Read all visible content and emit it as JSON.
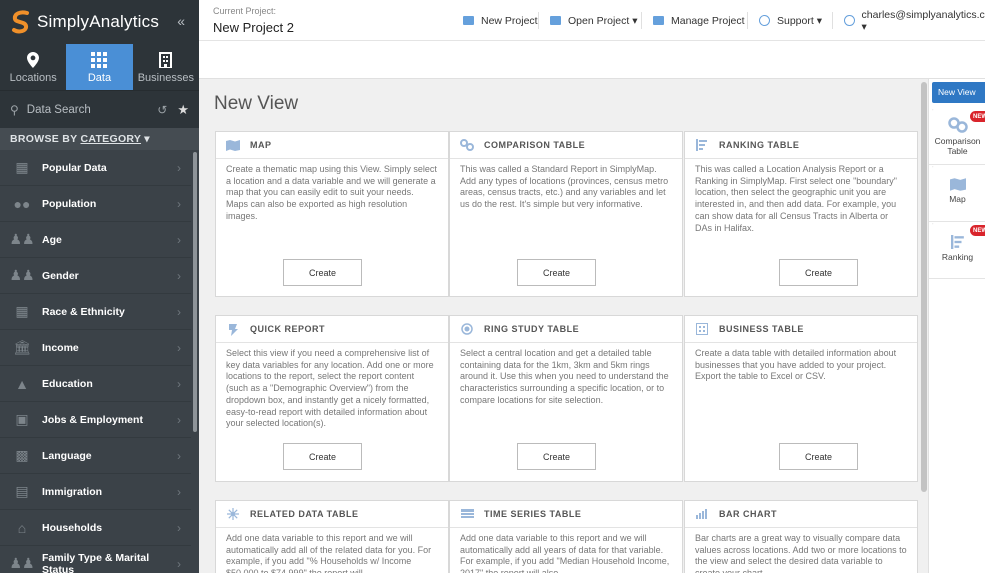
{
  "app": {
    "name": "SimplyAnalytics",
    "collapse_glyph": "«"
  },
  "sidebar": {
    "tabs": [
      {
        "label": "Locations",
        "icon": "map-pin-icon",
        "active": false
      },
      {
        "label": "Data",
        "icon": "data-grid-icon",
        "active": true
      },
      {
        "label": "Businesses",
        "icon": "building-icon",
        "active": false
      }
    ],
    "search_placeholder": "Data Search",
    "browse_prefix": "BROWSE BY ",
    "browse_link": "CATEGORY",
    "browse_caret": "▾",
    "categories": [
      {
        "label": "Popular Data",
        "icon": "popular-data-icon"
      },
      {
        "label": "Population",
        "icon": "population-icon"
      },
      {
        "label": "Age",
        "icon": "age-icon"
      },
      {
        "label": "Gender",
        "icon": "gender-icon"
      },
      {
        "label": "Race & Ethnicity",
        "icon": "race-ethnicity-icon"
      },
      {
        "label": "Income",
        "icon": "income-icon"
      },
      {
        "label": "Education",
        "icon": "education-icon"
      },
      {
        "label": "Jobs & Employment",
        "icon": "briefcase-icon"
      },
      {
        "label": "Language",
        "icon": "language-icon"
      },
      {
        "label": "Immigration",
        "icon": "immigration-icon"
      },
      {
        "label": "Households",
        "icon": "house-icon"
      },
      {
        "label": "Family Type & Marital Status",
        "icon": "family-icon"
      }
    ]
  },
  "topbar": {
    "project_label": "Current Project:",
    "project_name": "New Project 2",
    "new_project": "New Project",
    "open_project": "Open Project ▾",
    "manage_project": "Manage Project",
    "support": "Support ▾",
    "user": "charles@simplyanalytics.com ▾"
  },
  "main": {
    "title": "New View",
    "create_label": "Create",
    "cards": [
      {
        "title": "MAP",
        "icon": "map-icon",
        "desc": "Create a thematic map using this View. Simply select a location and a data variable and we will generate a map that you can easily edit to suit your needs. Maps can also be exported as high resolution images."
      },
      {
        "title": "COMPARISON TABLE",
        "icon": "comparison-table-icon",
        "desc": "This was called a Standard Report in SimplyMap. Add any types of locations (provinces, census metro areas, census tracts, etc.) and any variables and let us do the rest. It's simple but very informative."
      },
      {
        "title": "RANKING TABLE",
        "icon": "ranking-table-icon",
        "desc": "This was called a Location Analysis Report or a Ranking in SimplyMap. First select one \"boundary\" location, then select the geographic unit you are interested in, and then add data. For example, you can show data for all Census Tracts in Alberta or DAs in Halifax."
      },
      {
        "title": "QUICK REPORT",
        "icon": "quick-report-icon",
        "desc": "Select this view if you need a comprehensive list of key data variables for any location. Add one or more locations to the report, select the report content (such as a \"Demographic Overview\") from the dropdown box, and instantly get a nicely formatted, easy-to-read report with detailed information about your selected location(s)."
      },
      {
        "title": "RING STUDY TABLE",
        "icon": "ring-study-icon",
        "desc": "Select a central location and get a detailed table containing data for the 1km, 3km and 5km rings around it. Use this when you need to understand the characteristics surrounding a specific location, or to compare locations for site selection."
      },
      {
        "title": "BUSINESS TABLE",
        "icon": "business-table-icon",
        "desc": "Create a data table with detailed information about businesses that you have added to your project. Export the table to Excel or CSV."
      },
      {
        "title": "RELATED DATA TABLE",
        "icon": "related-data-icon",
        "desc": "Add one data variable to this report and we will automatically add all of the related data for you. For example, if you add \"% Households w/ Income $50,000 to $74,999\" the report will"
      },
      {
        "title": "TIME SERIES TABLE",
        "icon": "time-series-icon",
        "desc": "Add one data variable to this report and we will automatically add all years of data for that variable. For example, if you add \"Median Household Income, 2017\" the report will also"
      },
      {
        "title": "BAR CHART",
        "icon": "bar-chart-icon",
        "desc": "Bar charts are a great way to visually compare data values across locations. Add two or more locations to the view and select the desired data variable to create your chart."
      }
    ]
  },
  "right_panel": {
    "new_view": "New View",
    "badge": "NEW",
    "items": [
      {
        "label": "Comparison Table",
        "icon": "comparison-table-icon",
        "is_new": true
      },
      {
        "label": "Map",
        "icon": "map-icon",
        "is_new": false
      },
      {
        "label": "Ranking",
        "icon": "ranking-table-icon",
        "is_new": true
      }
    ]
  },
  "colors": {
    "accent": "#4a8fd6",
    "sidebar": "#3b4248",
    "sidebar_dark": "#2d3439",
    "badge": "#d9242b",
    "logo": "#f0902a"
  }
}
